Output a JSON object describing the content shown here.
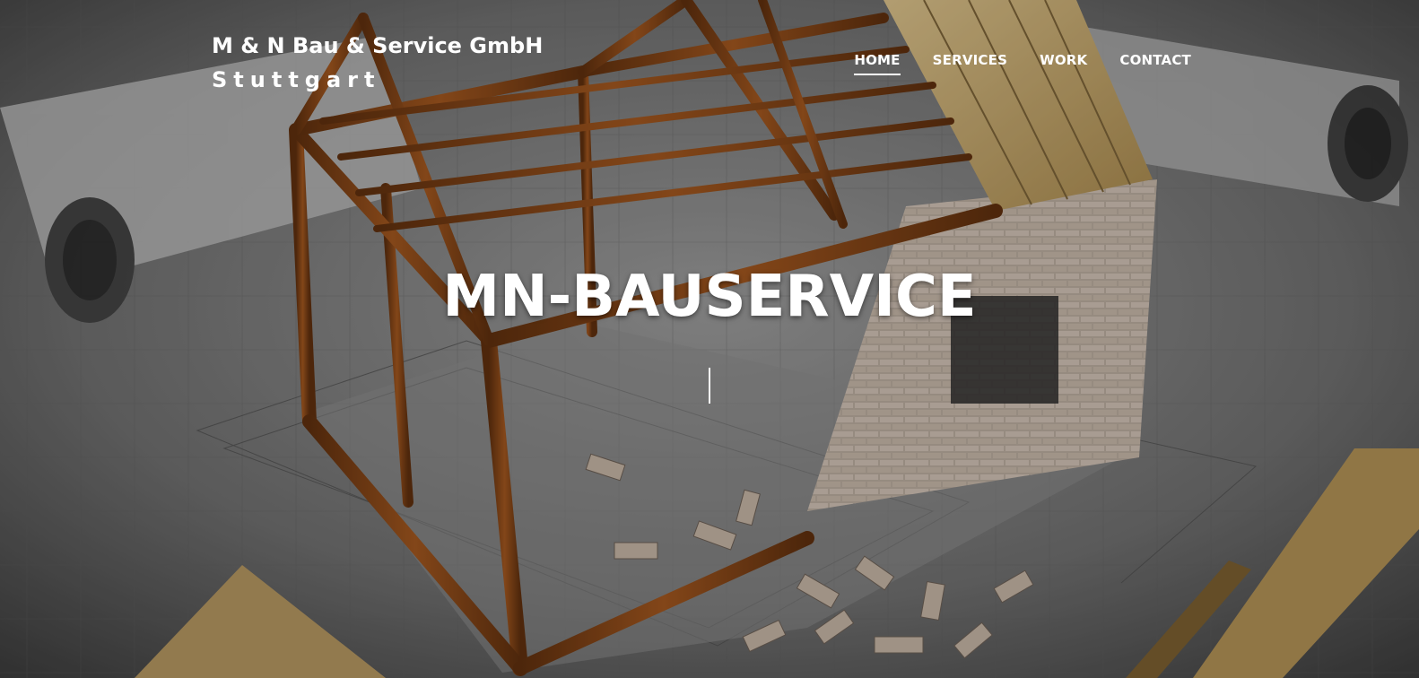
{
  "brand": {
    "name": "M & N Bau & Service GmbH",
    "city": "Stuttgart"
  },
  "nav": {
    "items": [
      {
        "label": "HOME",
        "active": true
      },
      {
        "label": "SERVICES",
        "active": false
      },
      {
        "label": "WORK",
        "active": false
      },
      {
        "label": "CONTACT",
        "active": false
      }
    ]
  },
  "hero": {
    "title": "MN-BAUSERVICE",
    "background_icon": "construction-house-blueprint-image"
  },
  "colors": {
    "text": "#ffffff",
    "wood": "#8a4a1a",
    "brick": "#c9b9aa",
    "paper": "#c9c9c9"
  }
}
